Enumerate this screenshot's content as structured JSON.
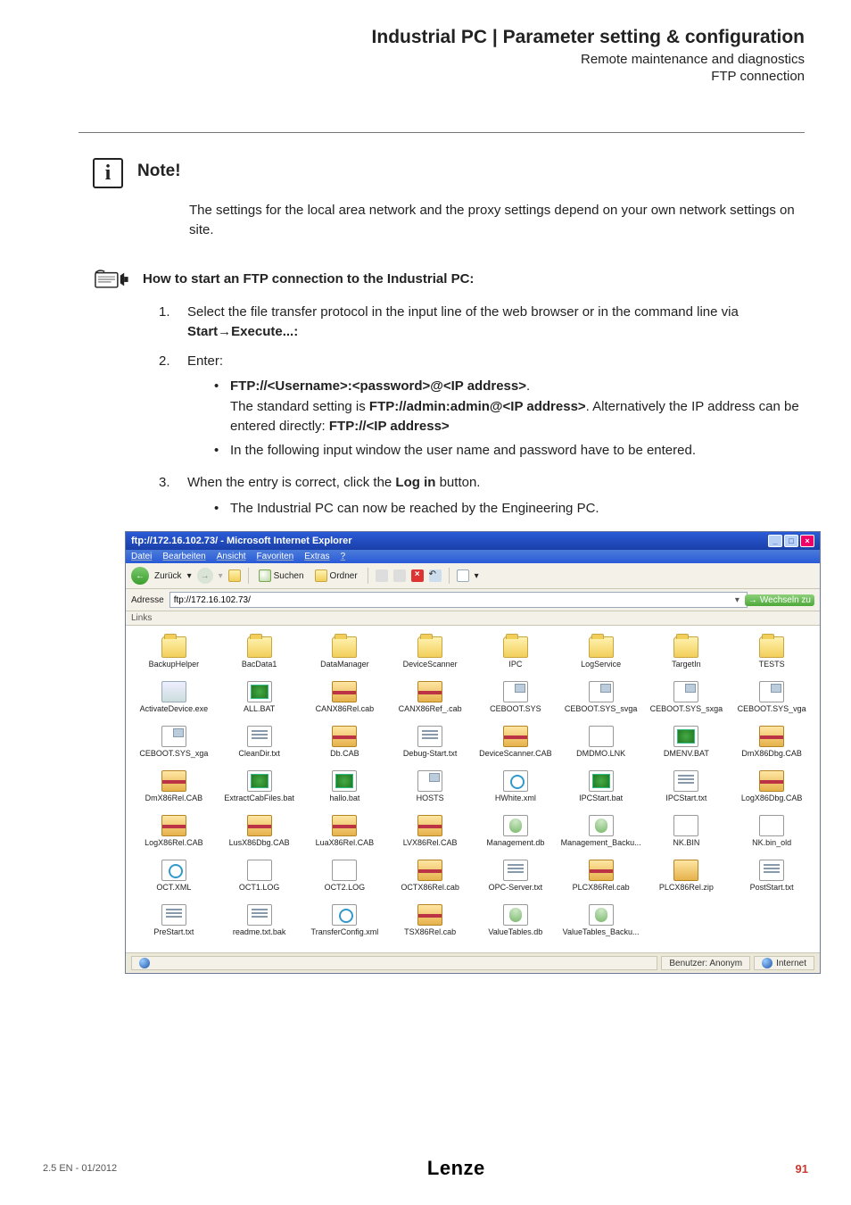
{
  "header": {
    "title": "Industrial PC | Parameter setting & configuration",
    "sub1": "Remote maintenance and diagnostics",
    "sub2": "FTP connection"
  },
  "note": {
    "label": "Note!",
    "text": "The settings for the local area network and the proxy settings depend on your own network settings on site."
  },
  "howto": {
    "title": "How to start an FTP connection to the Industrial PC:",
    "steps": {
      "s1_num": "1.",
      "s1_a": "Select the file transfer protocol in the input line of the web browser or in the command line via ",
      "s1_b": "Start→Execute...:",
      "s2_num": "2.",
      "s2_label": "Enter:",
      "s2_b1_a": "FTP://<Username>:<password>@<IP address>",
      "s2_b1_b": ".",
      "s2_b1_c": "The standard setting is ",
      "s2_b1_d": "FTP://admin:admin@<IP address>",
      "s2_b1_e": ". Alternatively the IP address can be entered directly: ",
      "s2_b1_f": "FTP://<IP address>",
      "s2_b2": "In the following input window the user name and password have to be entered.",
      "s3_num": "3.",
      "s3_a": "When the entry is correct, click the ",
      "s3_b": "Log in",
      "s3_c": " button.",
      "s3_b1": "The Industrial PC can now be reached by the Engineering PC."
    }
  },
  "screenshot": {
    "title": "ftp://172.16.102.73/ - Microsoft Internet Explorer",
    "menu": {
      "m1": "Datei",
      "m2": "Bearbeiten",
      "m3": "Ansicht",
      "m4": "Favoriten",
      "m5": "Extras",
      "m6": "?"
    },
    "toolbar": {
      "back": "Zurück",
      "suchen": "Suchen",
      "ordner": "Ordner"
    },
    "addr_label": "Adresse",
    "addr_value": "ftp://172.16.102.73/",
    "go": "Wechseln zu",
    "links": "Links",
    "files": [
      {
        "n": "BackupHelper",
        "t": "folder"
      },
      {
        "n": "BacData1",
        "t": "folder"
      },
      {
        "n": "DataManager",
        "t": "folder"
      },
      {
        "n": "DeviceScanner",
        "t": "folder"
      },
      {
        "n": "IPC",
        "t": "folder"
      },
      {
        "n": "LogService",
        "t": "folder"
      },
      {
        "n": "TargetIn",
        "t": "folder"
      },
      {
        "n": "TESTS",
        "t": "folder"
      },
      {
        "n": "ActivateDevice.exe",
        "t": "exe"
      },
      {
        "n": "ALL.BAT",
        "t": "bat"
      },
      {
        "n": "CANX86Rel.cab",
        "t": "cab"
      },
      {
        "n": "CANX86Ref_.cab",
        "t": "cab"
      },
      {
        "n": "CEBOOT.SYS",
        "t": "sys"
      },
      {
        "n": "CEBOOT.SYS_svga",
        "t": "sys"
      },
      {
        "n": "CEBOOT.SYS_sxga",
        "t": "sys"
      },
      {
        "n": "CEBOOT.SYS_vga",
        "t": "sys"
      },
      {
        "n": "CEBOOT.SYS_xga",
        "t": "sys"
      },
      {
        "n": "CleanDir.txt",
        "t": "txt"
      },
      {
        "n": "Db.CAB",
        "t": "cab"
      },
      {
        "n": "Debug-Start.txt",
        "t": "txt"
      },
      {
        "n": "DeviceScanner.CAB",
        "t": "cab"
      },
      {
        "n": "DMDMO.LNK",
        "t": "lnk"
      },
      {
        "n": "DMENV.BAT",
        "t": "bat"
      },
      {
        "n": "DmX86Dbg.CAB",
        "t": "cab"
      },
      {
        "n": "DmX86Rel.CAB",
        "t": "cab"
      },
      {
        "n": "ExtractCabFiles.bat",
        "t": "bat"
      },
      {
        "n": "hallo.bat",
        "t": "bat"
      },
      {
        "n": "HOSTS",
        "t": "sys"
      },
      {
        "n": "HWhite.xml",
        "t": "xml"
      },
      {
        "n": "IPCStart.bat",
        "t": "bat"
      },
      {
        "n": "IPCStart.txt",
        "t": "txt"
      },
      {
        "n": "LogX86Dbg.CAB",
        "t": "cab"
      },
      {
        "n": "LogX86Rel.CAB",
        "t": "cab"
      },
      {
        "n": "LusX86Dbg.CAB",
        "t": "cab"
      },
      {
        "n": "LuaX86Rel.CAB",
        "t": "cab"
      },
      {
        "n": "LVX86Rel.CAB",
        "t": "cab"
      },
      {
        "n": "Management.db",
        "t": "db"
      },
      {
        "n": "Management_Backu...",
        "t": "db"
      },
      {
        "n": "NK.BIN",
        "t": "bin"
      },
      {
        "n": "NK.bin_old",
        "t": "bin"
      },
      {
        "n": "OCT.XML",
        "t": "xml"
      },
      {
        "n": "OCT1.LOG",
        "t": "log"
      },
      {
        "n": "OCT2.LOG",
        "t": "log"
      },
      {
        "n": "OCTX86Rel.cab",
        "t": "cab"
      },
      {
        "n": "OPC-Server.txt",
        "t": "txt"
      },
      {
        "n": "PLCX86Rel.cab",
        "t": "cab"
      },
      {
        "n": "PLCX86Rel.zip",
        "t": "zip"
      },
      {
        "n": "PostStart.txt",
        "t": "txt"
      },
      {
        "n": "PreStart.txt",
        "t": "txt"
      },
      {
        "n": "readme.txt.bak",
        "t": "txt"
      },
      {
        "n": "TransferConfig.xml",
        "t": "xml"
      },
      {
        "n": "TSX86Rel.cab",
        "t": "cab"
      },
      {
        "n": "ValueTables.db",
        "t": "db"
      },
      {
        "n": "ValueTables_Backu...",
        "t": "db"
      }
    ],
    "status": {
      "user": "Benutzer: Anonym",
      "zone": "Internet"
    }
  },
  "footer": {
    "version": "2.5 EN - 01/2012",
    "logo": "Lenze",
    "page": "91"
  }
}
